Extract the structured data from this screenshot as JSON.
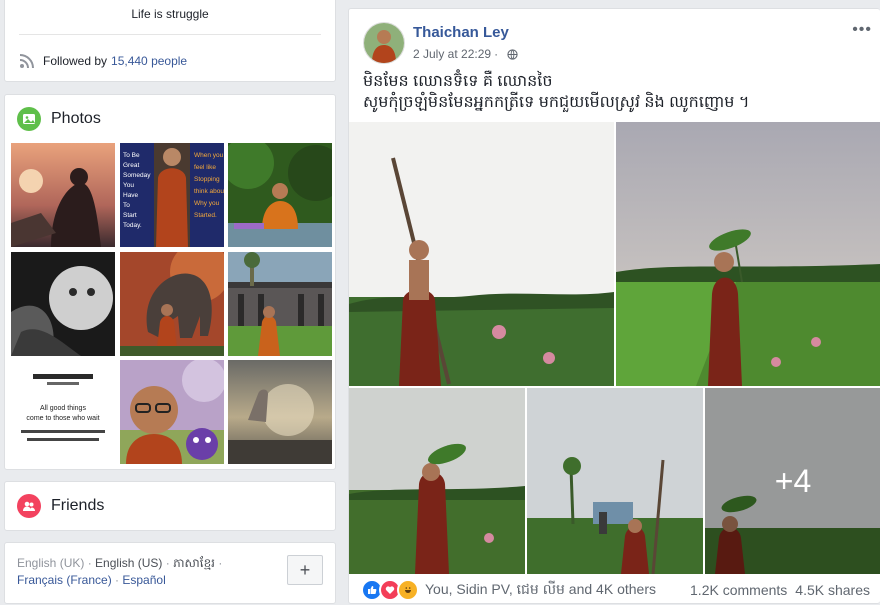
{
  "intro": {
    "bio": "Life is struggle",
    "followed_prefix": "Followed by",
    "followed_count": "15,440 people"
  },
  "photos": {
    "title": "Photos",
    "icon": "photo-icon",
    "accent": "#5fbf4a",
    "tile4_lines": [
      "All good things",
      "come to those who wait"
    ],
    "tile2_text": "To Be Great Someday You Have To Start Today",
    "tile2_text2": "When you feel like Stopping think about Why you Started."
  },
  "friends": {
    "title": "Friends",
    "icon": "friends-icon",
    "accent": "#f3425f"
  },
  "languages": {
    "current": "English (UK)",
    "others": [
      "English (US)",
      "ភាសាខ្មែរ",
      "Français (France)",
      "Español"
    ],
    "separator": "·",
    "plus_label": "+"
  },
  "post": {
    "author": "Thaichan Ley",
    "time": "2 July at 22:29",
    "more": "•••",
    "text_line1": "មិនមែន ឈោនទ៊ំទេ គឺ ឈោនចៃ",
    "text_line2": "សូមកុំច្រឡំមិនមែនអ្នកកត្រីទេ មកជួយមើលស្រូវ និង ឈូកញោម ។",
    "more_photos": "+4",
    "reactions_text": "You, Sidin PV, ជេម លីម and 4K others",
    "comments": "1.2K comments",
    "shares": "4.5K shares",
    "link_color": "#365899"
  }
}
